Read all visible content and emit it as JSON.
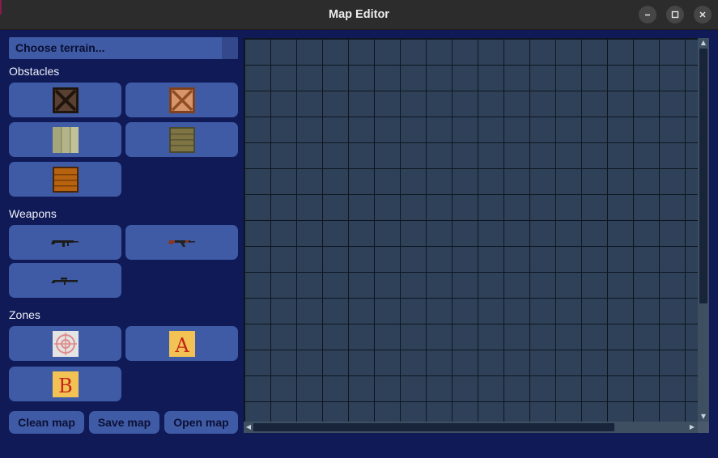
{
  "window": {
    "title": "Map Editor"
  },
  "terrain_select": {
    "selected": "Choose terrain..."
  },
  "sections": {
    "obstacles": "Obstacles",
    "weapons": "Weapons",
    "zones": "Zones"
  },
  "zones": {
    "a_label": "A",
    "b_label": "B"
  },
  "buttons": {
    "clean": "Clean map",
    "save": "Save map",
    "open": "Open map"
  },
  "icons": {
    "minimize": "minimize-icon",
    "maximize": "maximize-icon",
    "close": "close-icon"
  },
  "colors": {
    "background": "#0f1a57",
    "button": "#3f5ba6",
    "grid_cell": "#2f4158",
    "grid_line": "#0d1621"
  }
}
